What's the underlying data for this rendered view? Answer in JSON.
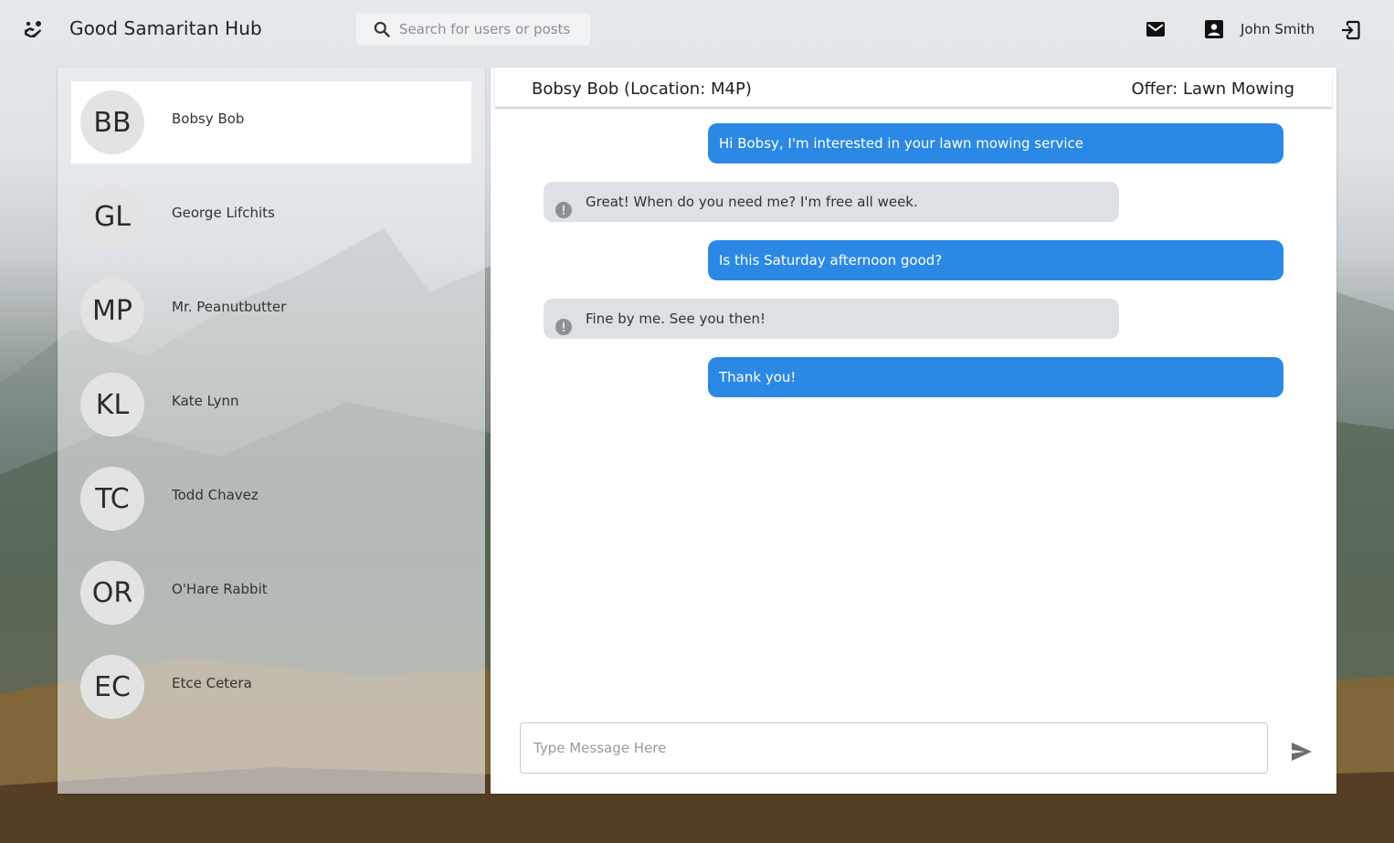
{
  "app": {
    "title": "Good Samaritan Hub",
    "logo_icon": "hands-heart-icon"
  },
  "search": {
    "placeholder": "Search for users or posts",
    "value": ""
  },
  "header_actions": {
    "mail_icon": "mail-icon",
    "account_icon": "account-box-icon",
    "user_name": "John Smith",
    "logout_icon": "logout-icon"
  },
  "contacts": [
    {
      "initials": "BB",
      "name": "Bobsy Bob",
      "active": true
    },
    {
      "initials": "GL",
      "name": "George Lifchits",
      "active": false
    },
    {
      "initials": "MP",
      "name": "Mr. Peanutbutter",
      "active": false
    },
    {
      "initials": "KL",
      "name": "Kate Lynn",
      "active": false
    },
    {
      "initials": "TC",
      "name": "Todd Chavez",
      "active": false
    },
    {
      "initials": "OR",
      "name": "O'Hare Rabbit",
      "active": false
    },
    {
      "initials": "EC",
      "name": "Etce Cetera",
      "active": false
    }
  ],
  "chat": {
    "title": "Bobsy Bob (Location: M4P)",
    "offer": "Offer: Lawn Mowing",
    "messages": [
      {
        "direction": "out",
        "text": "Hi Bobsy, I'm interested in your lawn mowing service"
      },
      {
        "direction": "in",
        "text": "Great! When do you need me? I'm free all week."
      },
      {
        "direction": "out",
        "text": "Is this Saturday afternoon good?"
      },
      {
        "direction": "in",
        "text": "Fine by me. See you then!"
      },
      {
        "direction": "out",
        "text": "Thank you!"
      }
    ],
    "compose_placeholder": "Type Message Here",
    "compose_value": "",
    "send_icon": "send-icon"
  },
  "colors": {
    "outgoing_bubble": "#2b88e4",
    "incoming_bubble": "#dde0e5",
    "active_contact": "#ffffff"
  }
}
